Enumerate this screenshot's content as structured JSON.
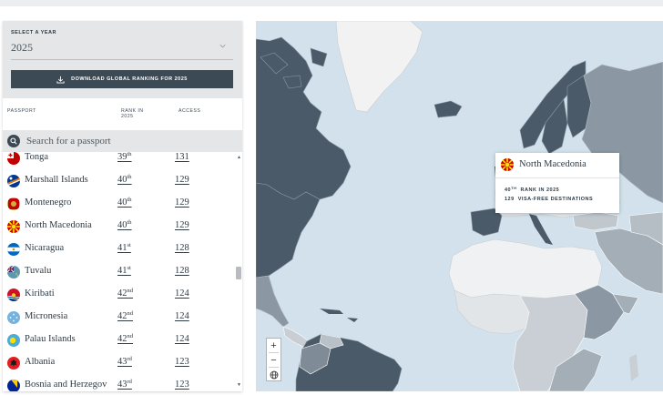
{
  "year_selector": {
    "label": "SELECT A YEAR",
    "value": "2025"
  },
  "download_button": {
    "label": "DOWNLOAD GLOBAL RANKING FOR 2025",
    "icon": "download-icon"
  },
  "columns": {
    "passport": "PASSPORT",
    "rank": "RANK IN 2025",
    "access": "ACCESS"
  },
  "search": {
    "placeholder": "Search for a passport",
    "icon": "search-icon"
  },
  "rows": [
    {
      "name": "Tonga",
      "rank": "39",
      "suffix": "th",
      "access": "131"
    },
    {
      "name": "Marshall Islands",
      "rank": "40",
      "suffix": "th",
      "access": "129"
    },
    {
      "name": "Montenegro",
      "rank": "40",
      "suffix": "th",
      "access": "129"
    },
    {
      "name": "North Macedonia",
      "rank": "40",
      "suffix": "th",
      "access": "129"
    },
    {
      "name": "Nicaragua",
      "rank": "41",
      "suffix": "st",
      "access": "128"
    },
    {
      "name": "Tuvalu",
      "rank": "41",
      "suffix": "st",
      "access": "128"
    },
    {
      "name": "Kiribati",
      "rank": "42",
      "suffix": "nd",
      "access": "124"
    },
    {
      "name": "Micronesia",
      "rank": "42",
      "suffix": "nd",
      "access": "124"
    },
    {
      "name": "Palau Islands",
      "rank": "42",
      "suffix": "nd",
      "access": "124"
    },
    {
      "name": "Albania",
      "rank": "43",
      "suffix": "rd",
      "access": "123"
    },
    {
      "name": "Bosnia and Herzegov",
      "rank": "43",
      "suffix": "rd",
      "access": "123"
    }
  ],
  "tooltip": {
    "country": "North Macedonia",
    "rank": "40",
    "rank_suffix": "TH",
    "rank_text": "RANK IN 2025",
    "access": "129",
    "access_text": "VISA-FREE DESTINATIONS"
  },
  "map_controls": {
    "zoom_in": "+",
    "zoom_out": "−"
  },
  "colors": {
    "accent_dark": "#3c4a56",
    "ocean": "#d2e1eb",
    "land_light": "#f2f2f2",
    "land_dark": "#4a5a68"
  }
}
